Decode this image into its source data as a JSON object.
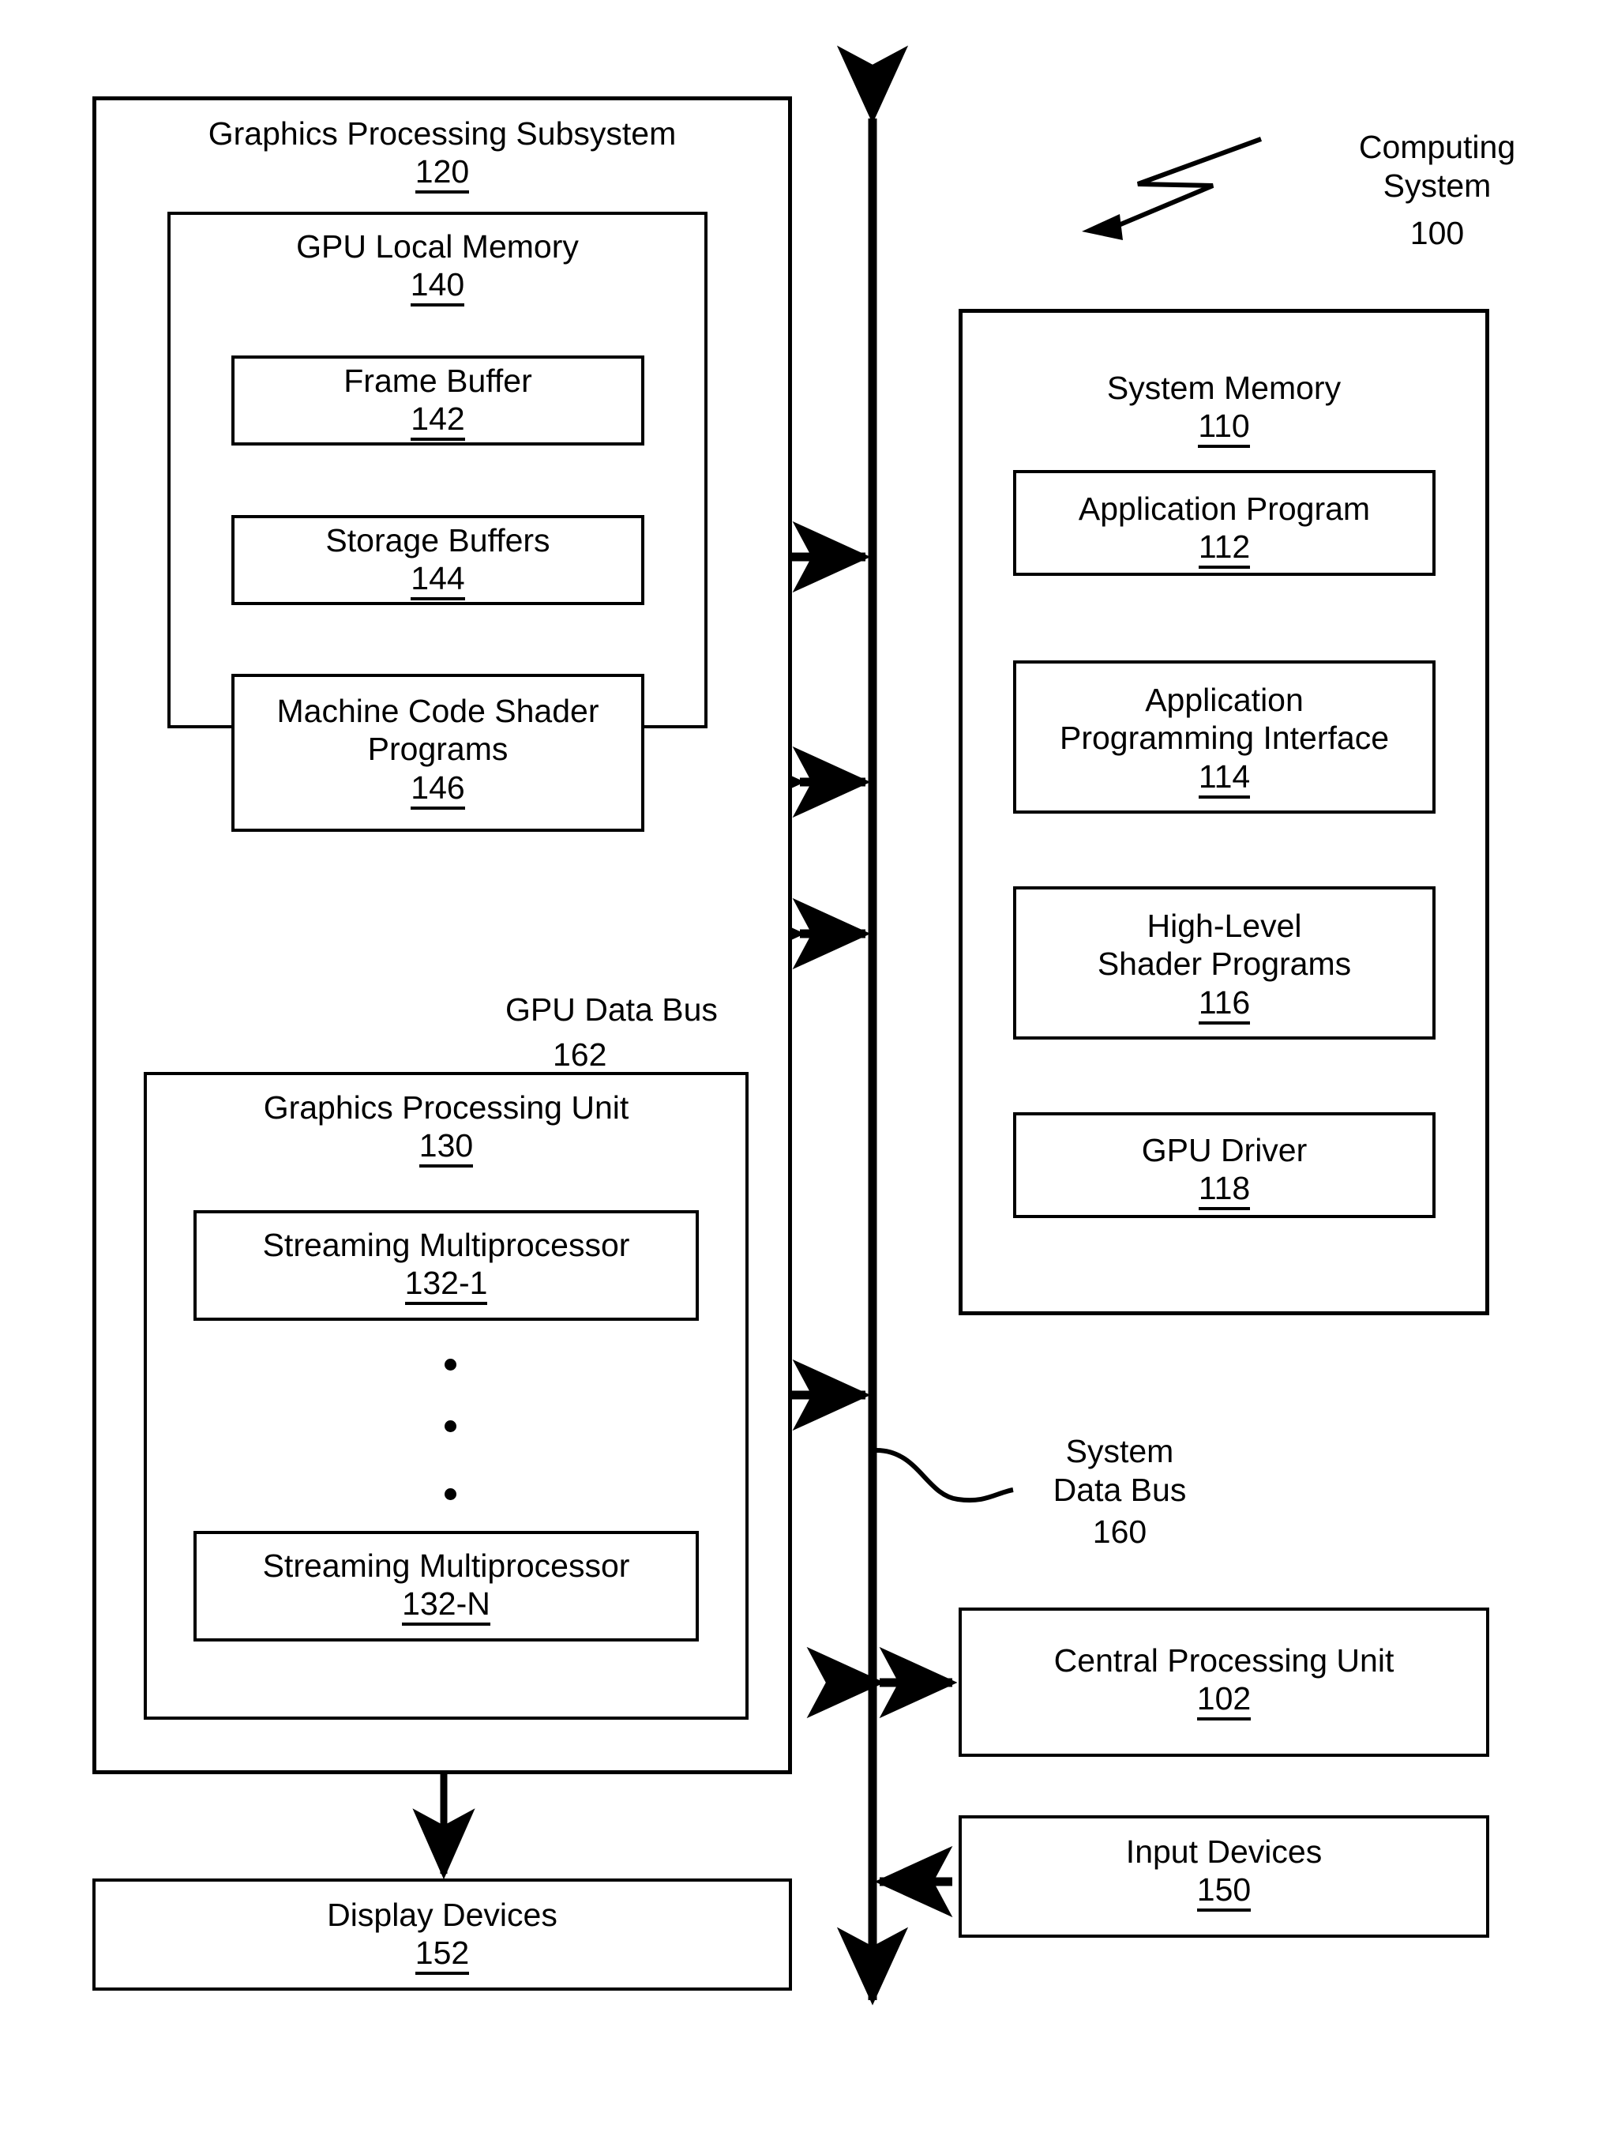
{
  "figure": {
    "title": "Computing System block diagram",
    "accent_color": "#000000",
    "background_color": "#ffffff"
  },
  "computing_system": {
    "label": "Computing\nSystem",
    "number": "100",
    "leader": "zigzag-leader-line"
  },
  "gps": {
    "title": "Graphics Processing Subsystem",
    "number": "120"
  },
  "gpu_local_memory": {
    "title": "GPU Local Memory",
    "number": "140",
    "children": [
      {
        "title": "Frame Buffer",
        "number": "142"
      },
      {
        "title": "Storage Buffers",
        "number": "144"
      },
      {
        "title": "Machine Code Shader\nPrograms",
        "number": "146"
      }
    ]
  },
  "gpu": {
    "title": "Graphics Processing Unit",
    "number": "130",
    "children": [
      {
        "title": "Streaming Multiprocessor",
        "number": "132-1"
      },
      {
        "title": "Streaming Multiprocessor",
        "number": "132-N"
      }
    ],
    "ellipsis": "vertical-ellipsis-three-dots"
  },
  "display_devices": {
    "title": "Display Devices",
    "number": "152"
  },
  "system_memory": {
    "title": "System Memory",
    "number": "110",
    "children": [
      {
        "title": "Application Program",
        "number": "112"
      },
      {
        "title": "Application\nProgramming Interface",
        "number": "114"
      },
      {
        "title": "High-Level\nShader Programs",
        "number": "116"
      },
      {
        "title": "GPU Driver",
        "number": "118"
      }
    ]
  },
  "cpu": {
    "title": "Central Processing Unit",
    "number": "102"
  },
  "input_devices": {
    "title": "Input Devices",
    "number": "150"
  },
  "buses": {
    "gpu_data_bus": {
      "label": "GPU Data Bus",
      "number": "162"
    },
    "system_data_bus": {
      "label": "System\nData Bus",
      "number": "160"
    }
  },
  "connections": [
    {
      "name": "gpu-local-memory-to-system-bus",
      "type": "double-arrow-horizontal"
    },
    {
      "name": "gps-to-system-bus-api",
      "type": "double-arrow-horizontal"
    },
    {
      "name": "gps-to-system-bus-shader",
      "type": "double-arrow-horizontal"
    },
    {
      "name": "gpu-to-system-bus",
      "type": "double-arrow-horizontal"
    },
    {
      "name": "cpu-to-system-bus",
      "type": "double-arrow-horizontal"
    },
    {
      "name": "input-devices-to-system-bus",
      "type": "single-arrow-left"
    },
    {
      "name": "gpu-data-bus-arrow",
      "type": "double-arrow-vertical"
    },
    {
      "name": "gpu-to-display-devices",
      "type": "single-arrow-down"
    },
    {
      "name": "system-data-bus-spine",
      "type": "double-arrow-vertical"
    }
  ]
}
